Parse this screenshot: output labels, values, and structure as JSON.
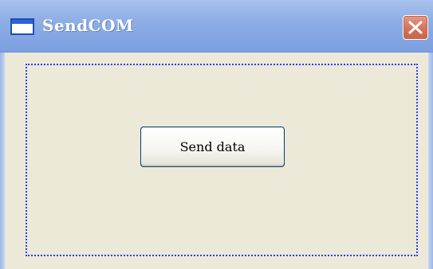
{
  "window": {
    "title": "SendCOM",
    "icon": "window-icon",
    "close_icon": "close-icon",
    "accent": "#7c9fe0",
    "close_color": "#d67358",
    "focus_color": "#2a3cff"
  },
  "main": {
    "send_button_label": "Send data"
  }
}
